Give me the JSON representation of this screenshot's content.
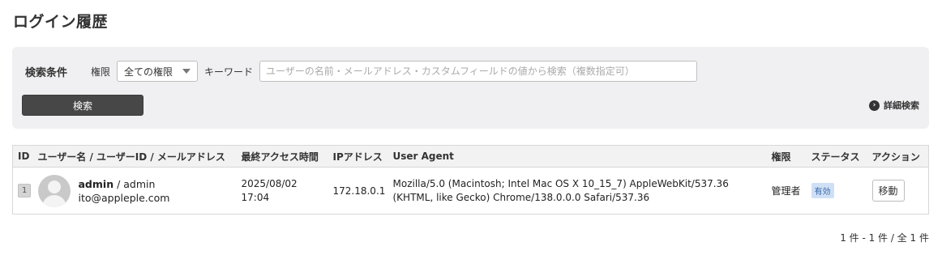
{
  "page": {
    "title": "ログイン履歴"
  },
  "search": {
    "label": "検索条件",
    "role_label": "権限",
    "role_selected": "全ての権限",
    "keyword_label": "キーワード",
    "keyword_placeholder": "ユーザーの名前・メールアドレス・カスタムフィールドの値から検索（複数指定可）",
    "keyword_value": "",
    "search_button": "検索",
    "detail_search": "詳細検索"
  },
  "table": {
    "headers": [
      "ID",
      "ユーザー名 / ユーザーID / メールアドレス",
      "最終アクセス時間",
      "IPアドレス",
      "User Agent",
      "権限",
      "ステータス",
      "アクション"
    ],
    "rows": [
      {
        "id": "1",
        "username": "admin",
        "separator": " / ",
        "user_id": "admin",
        "email": "ito@appleple.com",
        "date": "2025/08/02",
        "time": "17:04",
        "ip": "172.18.0.1",
        "ua_line1": "Mozilla/5.0 (Macintosh; Intel Mac OS X 10_15_7) AppleWebKit/537.36",
        "ua_line2": "(KHTML, like Gecko) Chrome/138.0.0.0 Safari/537.36",
        "role": "管理者",
        "status": "有効",
        "action": "移動"
      }
    ]
  },
  "pagination": {
    "text": "1 件 - 1 件 / 全 1 件"
  },
  "colors": {
    "primary_button": "#474747",
    "panel_bg": "#f0f0f2",
    "status_badge_bg": "#cfe0f6",
    "status_badge_text": "#3464a6"
  },
  "icons": {
    "detail_search": "chevron-right-circle-icon",
    "avatar": "default-user-avatar",
    "role_dropdown": "caret-down-icon"
  }
}
